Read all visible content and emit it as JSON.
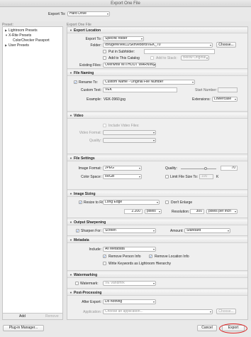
{
  "window": {
    "title": "Export One File"
  },
  "top": {
    "export_to_label": "Export To:",
    "export_to_value": "Hard Drive"
  },
  "sidebar": {
    "header": "Preset:",
    "items": [
      {
        "label": "Lightroom Presets",
        "expanded": false
      },
      {
        "label": "X-Rite Presets",
        "expanded": true
      },
      {
        "label": "ColorChecker Passport",
        "child": true
      },
      {
        "label": "User Presets",
        "expanded": false
      }
    ],
    "add_label": "Add",
    "remove_label": "Remove"
  },
  "main": {
    "header": "Export One File",
    "export_location": {
      "title": "Export Location",
      "export_to_label": "Export To:",
      "export_to_value": "Specific folder",
      "folder_label": "Folder:",
      "folder_value": "/Brugere/vek11/Skrivebord/VEK_70",
      "choose_label": "Choose...",
      "subfolder_label": "Put in Subfolder:",
      "add_catalog_label": "Add to This Catalog",
      "add_stack_label": "Add to Stack:",
      "stack_value": "Below Original",
      "existing_label": "Existing Files:",
      "existing_value": "Overwrite WITHOUT WARNING"
    },
    "file_naming": {
      "title": "File Naming",
      "rename_label": "Rename To:",
      "rename_value": "Custom Name - Original File Number",
      "custom_text_label": "Custom Text:",
      "custom_text_value": "VEK",
      "start_number_label": "Start Number:",
      "example_label": "Example:",
      "example_value": "VEK-3960.jpg",
      "extensions_label": "Extensions:",
      "extensions_value": "Lowercase"
    },
    "video": {
      "title": "Video",
      "include_label": "Include Video Files:",
      "format_label": "Video Format:",
      "quality_label": "Quality:"
    },
    "file_settings": {
      "title": "File Settings",
      "format_label": "Image Format:",
      "format_value": "JPEG",
      "quality_label": "Quality:",
      "quality_value": "70",
      "quality_fraction": 0.7,
      "colorspace_label": "Color Space:",
      "colorspace_value": "sRGB",
      "limit_label": "Limit File Size To:",
      "limit_value": "100",
      "limit_unit": "K"
    },
    "image_sizing": {
      "title": "Image Sizing",
      "resize_label": "Resize to Fit:",
      "resize_value": "Long Edge",
      "dont_enlarge_label": "Don't Enlarge",
      "size_value": "2.200",
      "size_unit": "pixels",
      "resolution_label": "Resolution:",
      "resolution_value": "300",
      "resolution_unit": "pixels per inch"
    },
    "output_sharpening": {
      "title": "Output Sharpening",
      "sharpen_label": "Sharpen For:",
      "sharpen_value": "Screen",
      "amount_label": "Amount:",
      "amount_value": "Standard"
    },
    "metadata": {
      "title": "Metadata",
      "include_label": "Include:",
      "include_value": "All Metadata",
      "remove_person_label": "Remove Person Info",
      "remove_location_label": "Remove Location Info",
      "write_keywords_label": "Write Keywords as Lightroom Hierarchy"
    },
    "watermarking": {
      "title": "Watermarking",
      "watermark_label": "Watermark:",
      "watermark_value": "VE Vandmrk"
    },
    "post_processing": {
      "title": "Post-Processing",
      "after_label": "After Export:",
      "after_value": "Do nothing",
      "application_label": "Application:",
      "application_value": "Choose an application...",
      "choose_label": "Choose..."
    }
  },
  "bottom": {
    "plugin_label": "Plug-in Manager...",
    "cancel_label": "Cancel",
    "export_label": "Export"
  },
  "colors": {
    "accent": "#1a5fd0",
    "highlight_ring": "#dd2222"
  }
}
